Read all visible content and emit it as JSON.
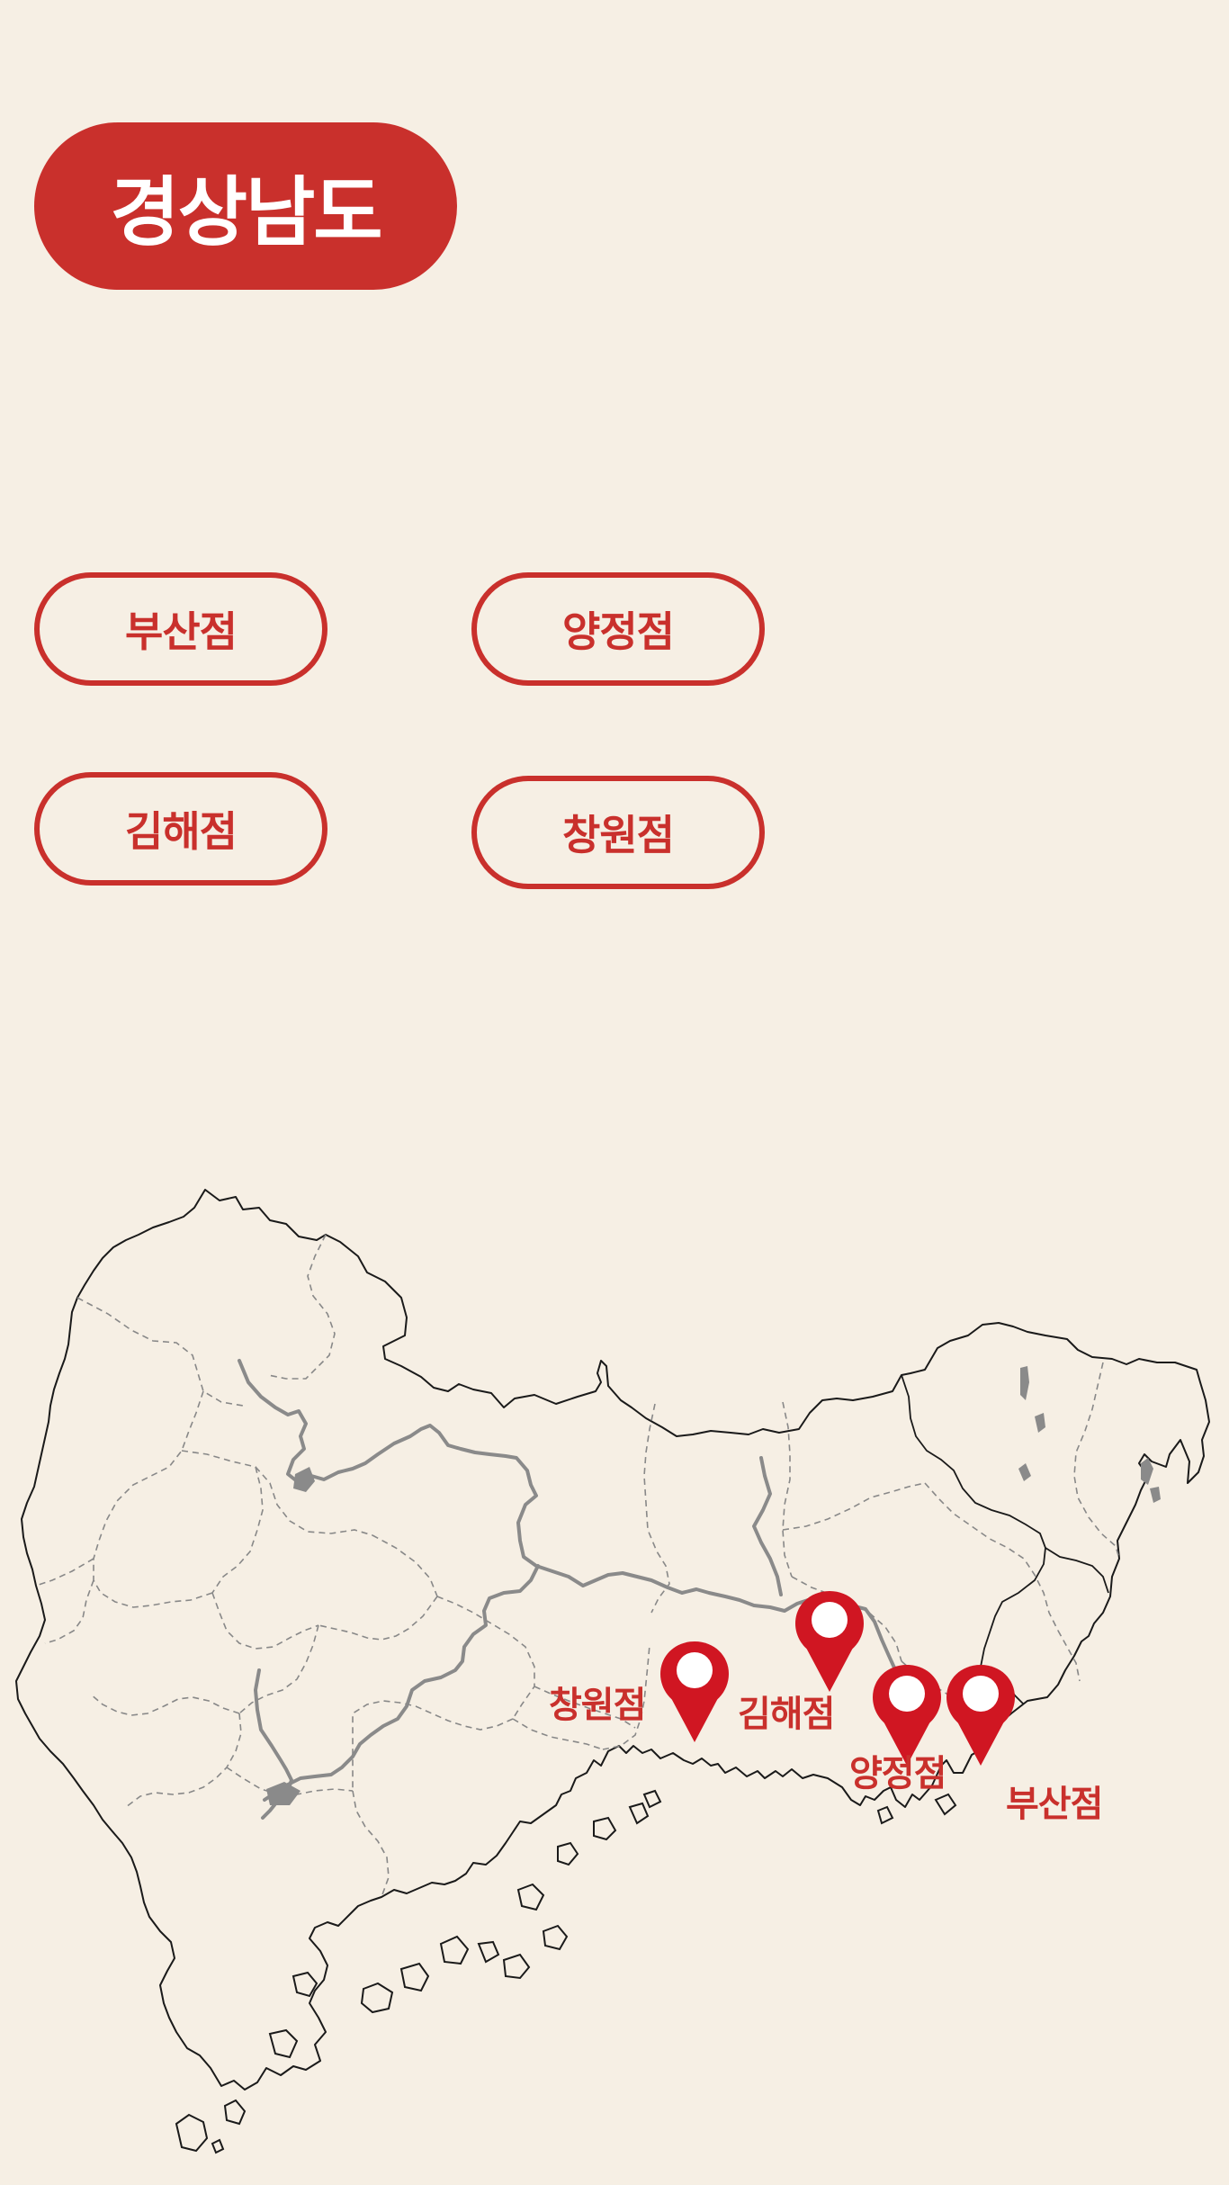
{
  "header": {
    "region_title": "경상남도"
  },
  "stores": {
    "busan_label": "부산점",
    "yangjeong_label": "양정점",
    "gimhae_label": "김해점",
    "changwon_label": "창원점"
  },
  "map": {
    "markers": {
      "changwon": "창원점",
      "gimhae": "김해점",
      "yangjeong": "양정점",
      "busan": "부산점"
    }
  },
  "colors": {
    "background": "#f6efe4",
    "accent": "#c9302c",
    "marker": "#d01622",
    "boundary": "#1a1a1a",
    "river": "#8a8a8a",
    "district_line": "#888888"
  }
}
